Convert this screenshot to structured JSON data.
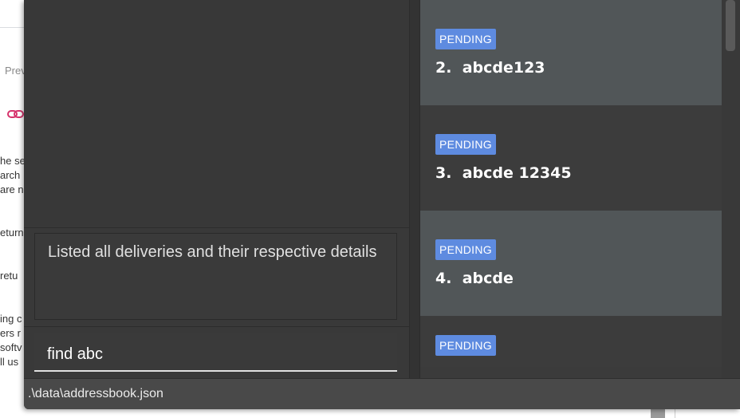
{
  "background_page": {
    "preview_fragment": "Prev",
    "text_fragments": [
      "he se",
      "arch",
      "are n",
      "eturn",
      "retu",
      "ing c",
      "ers r",
      "softv",
      "ll us"
    ]
  },
  "result_display": {
    "text": "Listed all deliveries and their respective details"
  },
  "command_box": {
    "value": "find abc"
  },
  "delivery_list": [
    {
      "status": "PENDING",
      "index": "2.",
      "name": "abcde123"
    },
    {
      "status": "PENDING",
      "index": "3.",
      "name": "abcde 12345"
    },
    {
      "status": "PENDING",
      "index": "4.",
      "name": "abcde"
    },
    {
      "status": "PENDING",
      "index": "",
      "name": ""
    }
  ],
  "status_bar": {
    "path": ".\\data\\addressbook.json"
  },
  "colors": {
    "badge": "#5e8be0",
    "card_alt": "#515658",
    "card": "#3c3c3c",
    "window": "#3b3b3b",
    "link_icon": "#d6336c"
  },
  "icons": {
    "link": "link-icon"
  }
}
